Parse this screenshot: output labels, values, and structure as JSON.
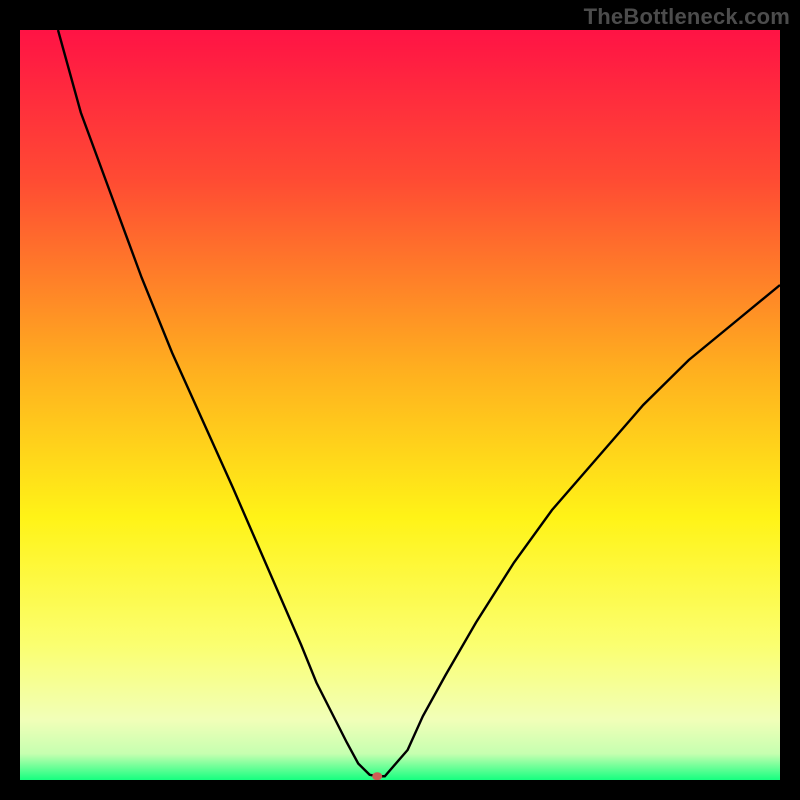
{
  "watermark": "TheBottleneck.com",
  "chart_data": {
    "type": "line",
    "title": "",
    "xlabel": "",
    "ylabel": "",
    "xlim": [
      0,
      100
    ],
    "ylim": [
      0,
      100
    ],
    "grid": false,
    "legend": false,
    "background_gradient": {
      "stops": [
        {
          "offset": 0.0,
          "color": "#ff1345"
        },
        {
          "offset": 0.2,
          "color": "#ff4b33"
        },
        {
          "offset": 0.45,
          "color": "#ffae1f"
        },
        {
          "offset": 0.65,
          "color": "#fff317"
        },
        {
          "offset": 0.82,
          "color": "#fbff70"
        },
        {
          "offset": 0.92,
          "color": "#f1ffb8"
        },
        {
          "offset": 0.965,
          "color": "#c6ffb0"
        },
        {
          "offset": 1.0,
          "color": "#16ff80"
        }
      ]
    },
    "series": [
      {
        "name": "bottleneck-curve",
        "stroke": "#000000",
        "stroke_width": 2.4,
        "x": [
          5,
          8,
          12,
          16,
          20,
          24,
          28,
          31,
          34,
          37,
          39,
          41,
          43,
          44.5,
          46,
          47,
          48,
          51,
          53,
          56,
          60,
          65,
          70,
          76,
          82,
          88,
          94,
          100
        ],
        "y": [
          100,
          89,
          78,
          67,
          57,
          48,
          39,
          32,
          25,
          18,
          13,
          9,
          5,
          2.2,
          0.7,
          0.5,
          0.5,
          4,
          8.5,
          14,
          21,
          29,
          36,
          43,
          50,
          56,
          61,
          66
        ]
      }
    ],
    "marker": {
      "name": "min-marker",
      "x": 47,
      "y": 0.5,
      "rx": 5,
      "ry": 4,
      "fill": "#cc5f55"
    }
  }
}
